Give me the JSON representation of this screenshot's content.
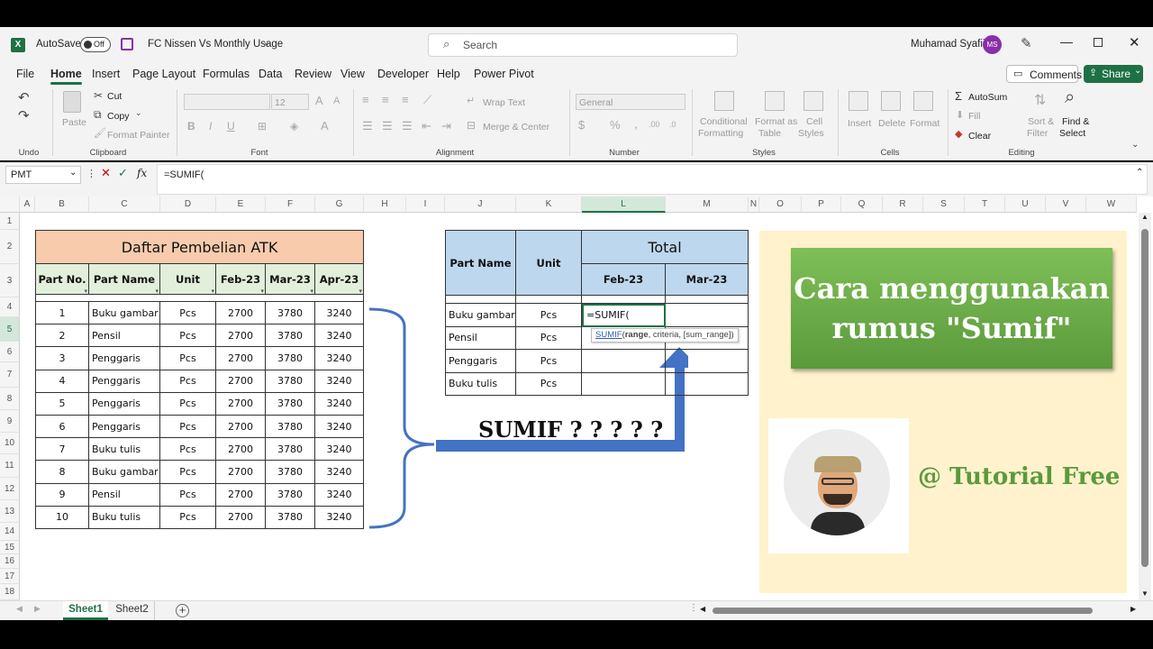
{
  "titlebar": {
    "autosave_label": "AutoSave",
    "autosave_state": "Off",
    "file_name": "FC Nissen Vs Monthly Usage",
    "search_placeholder": "Search",
    "user_name": "Muhamad Syafii",
    "user_initials": "MS"
  },
  "tabs": [
    "File",
    "Home",
    "Insert",
    "Page Layout",
    "Formulas",
    "Data",
    "Review",
    "View",
    "Developer",
    "Help",
    "Power Pivot"
  ],
  "actions": {
    "comments": "Comments",
    "share": "Share"
  },
  "ribbon": {
    "undo_group": "Undo",
    "clipboard": {
      "paste": "Paste",
      "cut": "Cut",
      "copy": "Copy",
      "format_painter": "Format Painter",
      "group": "Clipboard"
    },
    "font": {
      "size": "12",
      "group": "Font"
    },
    "alignment": {
      "wrap": "Wrap Text",
      "merge": "Merge & Center",
      "group": "Alignment"
    },
    "number": {
      "format": "General",
      "group": "Number"
    },
    "styles": {
      "conditional": "Conditional",
      "conditional2": "Formatting",
      "format_as": "Format as",
      "format_as2": "Table",
      "cell": "Cell",
      "cell2": "Styles",
      "group": "Styles"
    },
    "cells": {
      "insert": "Insert",
      "delete": "Delete",
      "format": "Format",
      "group": "Cells"
    },
    "editing": {
      "autosum": "AutoSum",
      "fill": "Fill",
      "clear": "Clear",
      "sort": "Sort &",
      "sort2": "Filter",
      "find": "Find &",
      "find2": "Select",
      "group": "Editing"
    }
  },
  "formula_bar": {
    "name_box": "PMT",
    "formula": "=SUMIF("
  },
  "columns": [
    "A",
    "B",
    "C",
    "D",
    "E",
    "F",
    "G",
    "H",
    "I",
    "J",
    "K",
    "L",
    "M",
    "N",
    "O",
    "P",
    "Q",
    "R",
    "S",
    "T",
    "U",
    "V",
    "W"
  ],
  "rows": [
    "1",
    "2",
    "3",
    "4",
    "5",
    "6",
    "7",
    "8",
    "9",
    "10",
    "11",
    "12",
    "13",
    "14",
    "15",
    "16",
    "17",
    "18"
  ],
  "table1": {
    "title": "Daftar Pembelian ATK",
    "headers": [
      "Part No.",
      "Part Name",
      "Unit",
      "Feb-23",
      "Mar-23",
      "Apr-23"
    ],
    "rows": [
      [
        "1",
        "Buku gambar",
        "Pcs",
        "2700",
        "3780",
        "3240"
      ],
      [
        "2",
        "Pensil",
        "Pcs",
        "2700",
        "3780",
        "3240"
      ],
      [
        "3",
        "Penggaris",
        "Pcs",
        "2700",
        "3780",
        "3240"
      ],
      [
        "4",
        "Penggaris",
        "Pcs",
        "2700",
        "3780",
        "3240"
      ],
      [
        "5",
        "Penggaris",
        "Pcs",
        "2700",
        "3780",
        "3240"
      ],
      [
        "6",
        "Penggaris",
        "Pcs",
        "2700",
        "3780",
        "3240"
      ],
      [
        "7",
        "Buku tulis",
        "Pcs",
        "2700",
        "3780",
        "3240"
      ],
      [
        "8",
        "Buku gambar",
        "Pcs",
        "2700",
        "3780",
        "3240"
      ],
      [
        "9",
        "Pensil",
        "Pcs",
        "2700",
        "3780",
        "3240"
      ],
      [
        "10",
        "Buku tulis",
        "Pcs",
        "2700",
        "3780",
        "3240"
      ]
    ]
  },
  "table2": {
    "part_name": "Part Name",
    "unit": "Unit",
    "total": "Total",
    "months": [
      "Feb-23",
      "Mar-23"
    ],
    "rows": [
      [
        "Buku gambar",
        "Pcs"
      ],
      [
        "Pensil",
        "Pcs"
      ],
      [
        "Penggaris",
        "Pcs"
      ],
      [
        "Buku tulis",
        "Pcs"
      ]
    ],
    "editing_cell": "=SUMIF(",
    "tooltip_fn": "SUMIF",
    "tooltip_args": "(range, criteria, [sum_range])",
    "tooltip_bold": "range"
  },
  "sumif_label": "SUMIF ? ? ? ? ?",
  "promo": {
    "line1": "Cara menggunakan",
    "line2": "rumus \"Sumif\"",
    "tutorial": "@ Tutorial Free"
  },
  "sheets": [
    "Sheet1",
    "Sheet2"
  ],
  "colors": {
    "excel_green": "#1e7145",
    "title_peach": "#f8cbad",
    "header_green": "#e2efda",
    "header_blue": "#bdd7ee",
    "panel_cream": "#fff2cc",
    "promo_green": "#70ad47",
    "arrow_blue": "#4472c4"
  }
}
